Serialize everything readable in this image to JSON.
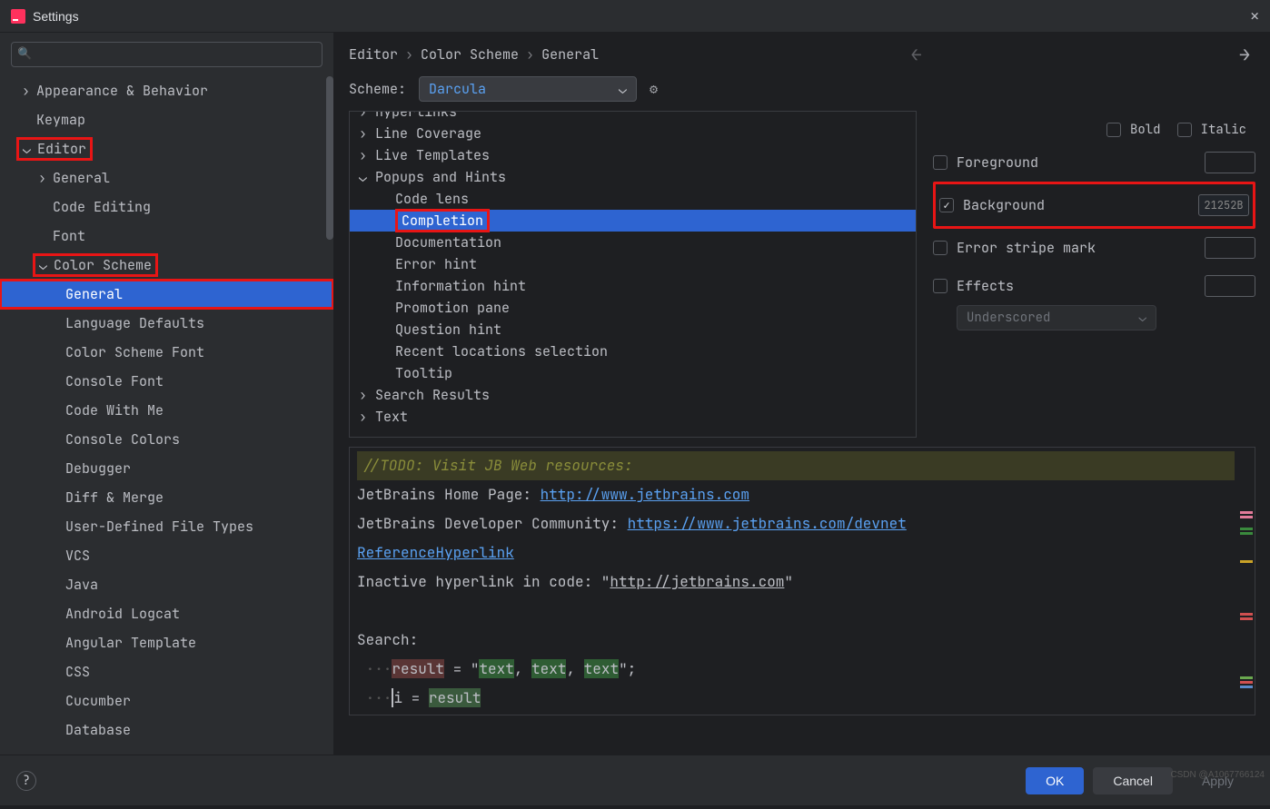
{
  "window": {
    "title": "Settings"
  },
  "sidebar": {
    "search_placeholder": "",
    "items": [
      {
        "label": "Appearance & Behavior",
        "level": 1,
        "chev": "right"
      },
      {
        "label": "Keymap",
        "level": 1,
        "chev": "none"
      },
      {
        "label": "Editor",
        "level": 1,
        "chev": "down",
        "hl": true
      },
      {
        "label": "General",
        "level": 2,
        "chev": "right"
      },
      {
        "label": "Code Editing",
        "level": 2,
        "chev": "none"
      },
      {
        "label": "Font",
        "level": 2,
        "chev": "none"
      },
      {
        "label": "Color Scheme",
        "level": 2,
        "chev": "down",
        "hl": true
      },
      {
        "label": "General",
        "level": 3,
        "chev": "none",
        "selected": true,
        "hl": true
      },
      {
        "label": "Language Defaults",
        "level": 3,
        "chev": "none"
      },
      {
        "label": "Color Scheme Font",
        "level": 3,
        "chev": "none"
      },
      {
        "label": "Console Font",
        "level": 3,
        "chev": "none"
      },
      {
        "label": "Code With Me",
        "level": 3,
        "chev": "none"
      },
      {
        "label": "Console Colors",
        "level": 3,
        "chev": "none"
      },
      {
        "label": "Debugger",
        "level": 3,
        "chev": "none"
      },
      {
        "label": "Diff & Merge",
        "level": 3,
        "chev": "none"
      },
      {
        "label": "User-Defined File Types",
        "level": 3,
        "chev": "none"
      },
      {
        "label": "VCS",
        "level": 3,
        "chev": "none"
      },
      {
        "label": "Java",
        "level": 3,
        "chev": "none"
      },
      {
        "label": "Android Logcat",
        "level": 3,
        "chev": "none"
      },
      {
        "label": "Angular Template",
        "level": 3,
        "chev": "none"
      },
      {
        "label": "CSS",
        "level": 3,
        "chev": "none"
      },
      {
        "label": "Cucumber",
        "level": 3,
        "chev": "none"
      },
      {
        "label": "Database",
        "level": 3,
        "chev": "none"
      }
    ]
  },
  "breadcrumb": [
    "Editor",
    "Color Scheme",
    "General"
  ],
  "scheme": {
    "label": "Scheme:",
    "value": "Darcula"
  },
  "options": [
    {
      "label": "Hyperlinks",
      "level": 1,
      "chev": "right",
      "cut": true
    },
    {
      "label": "Line Coverage",
      "level": 1,
      "chev": "right"
    },
    {
      "label": "Live Templates",
      "level": 1,
      "chev": "right"
    },
    {
      "label": "Popups and Hints",
      "level": 1,
      "chev": "down"
    },
    {
      "label": "Code lens",
      "level": 2,
      "chev": "none"
    },
    {
      "label": "Completion",
      "level": 2,
      "chev": "none",
      "selected": true,
      "hl": true
    },
    {
      "label": "Documentation",
      "level": 2,
      "chev": "none"
    },
    {
      "label": "Error hint",
      "level": 2,
      "chev": "none"
    },
    {
      "label": "Information hint",
      "level": 2,
      "chev": "none"
    },
    {
      "label": "Promotion pane",
      "level": 2,
      "chev": "none"
    },
    {
      "label": "Question hint",
      "level": 2,
      "chev": "none"
    },
    {
      "label": "Recent locations selection",
      "level": 2,
      "chev": "none"
    },
    {
      "label": "Tooltip",
      "level": 2,
      "chev": "none"
    },
    {
      "label": "Search Results",
      "level": 1,
      "chev": "right"
    },
    {
      "label": "Text",
      "level": 1,
      "chev": "right"
    }
  ],
  "attrs": {
    "bold": "Bold",
    "italic": "Italic",
    "foreground": "Foreground",
    "background": "Background",
    "background_value": "21252B",
    "error_stripe": "Error stripe mark",
    "effects": "Effects",
    "effects_value": "Underscored"
  },
  "preview": {
    "todo": "//TODO: Visit JB Web resources:",
    "l1a": "JetBrains Home Page: ",
    "l1link": "http://www.jetbrains.com",
    "l2a": "JetBrains Developer Community: ",
    "l2link": "https://www.jetbrains.com/devnet",
    "l3": "ReferenceHyperlink",
    "l4a": "Inactive hyperlink in code: \"",
    "l4link": "http://jetbrains.com",
    "l4b": "\"",
    "search": "Search:",
    "r1a": "result",
    "r1b": " = \"",
    "t1": "text",
    "r1c": ", ",
    "t2": "text",
    "t3": "text",
    "r1d": "\";",
    "r2a": "i",
    "r2b": " = ",
    "r2c": "result"
  },
  "footer": {
    "ok": "OK",
    "cancel": "Cancel",
    "apply": "Apply"
  },
  "watermark": "CSDN @A1067766124"
}
